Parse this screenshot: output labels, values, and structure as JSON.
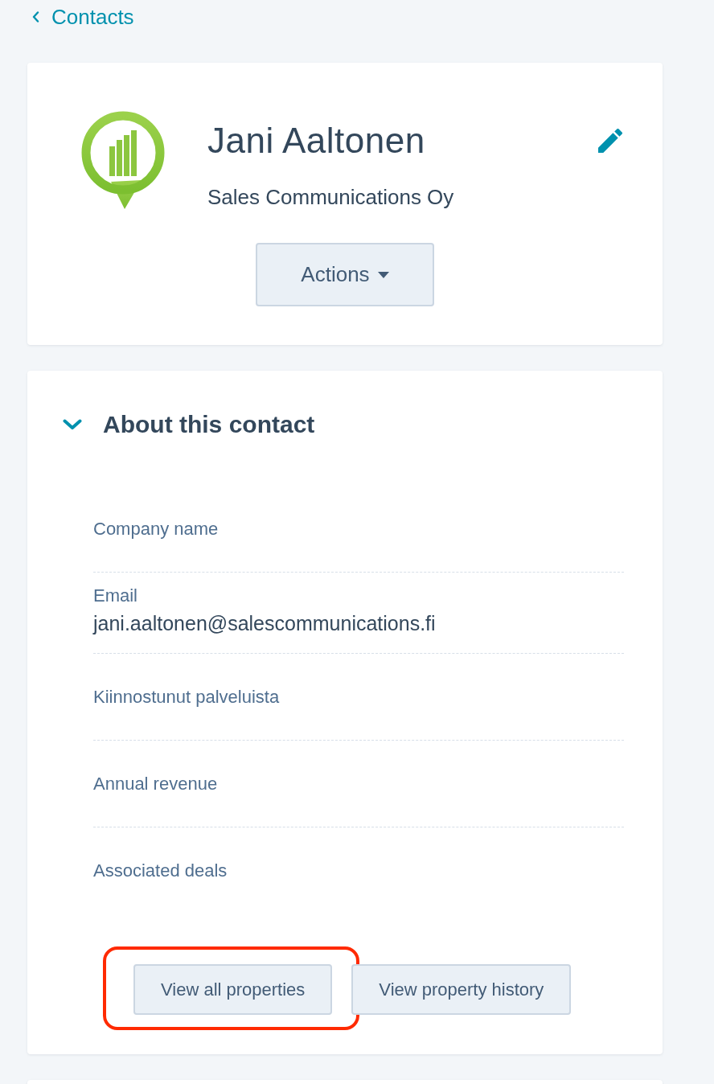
{
  "back_link": {
    "label": "Contacts"
  },
  "contact_card": {
    "name": "Jani Aaltonen",
    "company": "Sales Communications Oy",
    "actions_button": "Actions"
  },
  "about_section": {
    "title": "About this contact",
    "expanded": true,
    "properties": [
      {
        "label": "Company name"
      },
      {
        "label": "Email",
        "value": "jani.aaltonen@salescommunications.fi"
      },
      {
        "label": "Kiinnostunut palveluista"
      },
      {
        "label": "Annual revenue"
      },
      {
        "label": "Associated deals"
      }
    ],
    "buttons": [
      {
        "label": "View all properties",
        "highlighted": true
      },
      {
        "label": "View property history",
        "highlighted": false
      }
    ]
  }
}
